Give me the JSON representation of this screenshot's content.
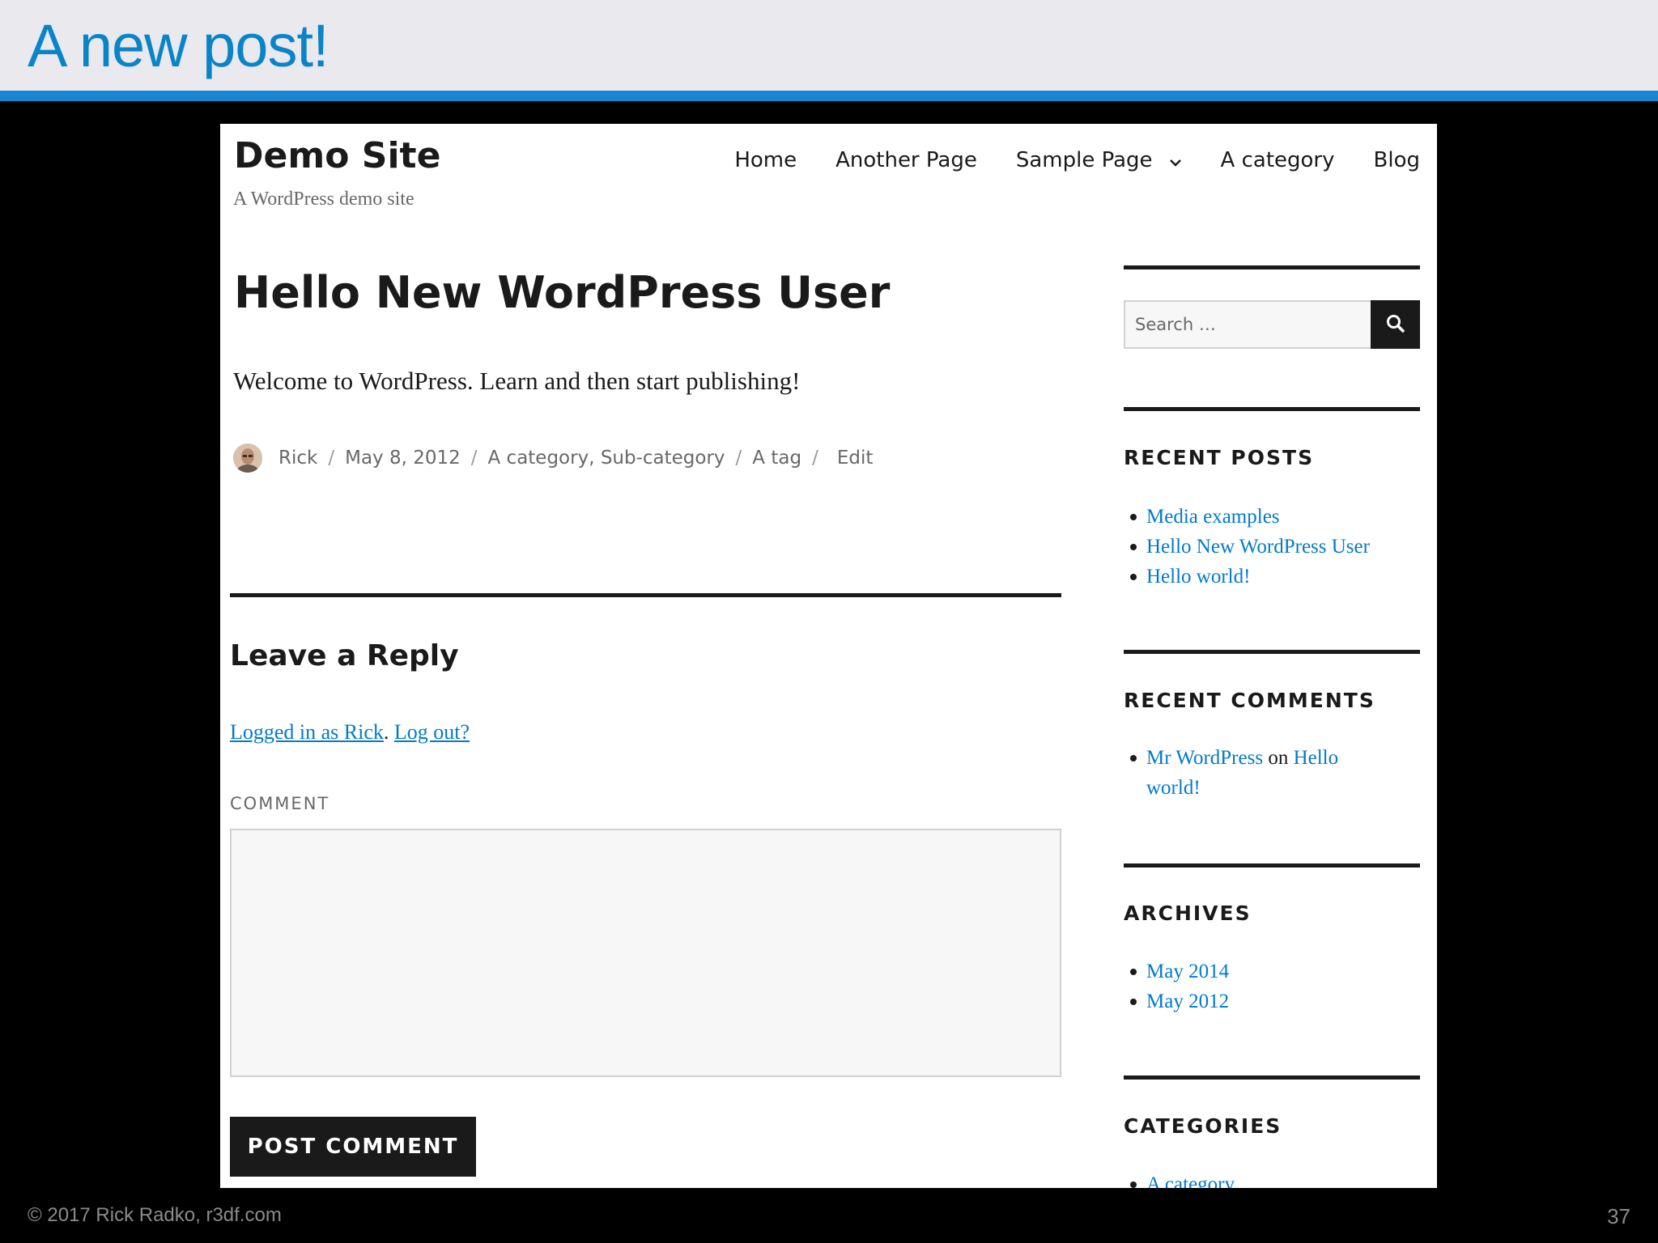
{
  "slide": {
    "title": "A new post!",
    "footer": "© 2017 Rick Radko, r3df.com",
    "page_number": "37"
  },
  "colors": {
    "slide_title": "#0a84c8",
    "slide_bar": "#1787d4",
    "link": "#007acc",
    "text": "#1a1a1a"
  },
  "site": {
    "title": "Demo Site",
    "description": "A WordPress demo site"
  },
  "nav": {
    "items": [
      "Home",
      "Another Page",
      "Sample Page",
      "A category",
      "Blog"
    ],
    "dropdown_icon": "chevron-down-icon"
  },
  "post": {
    "title": "Hello New WordPress User",
    "content": "Welcome to WordPress. Learn and then start publishing!",
    "author": "Rick",
    "date": "May 8, 2012",
    "categories": "A category, Sub-category",
    "tag": "A tag",
    "edit": "Edit",
    "separator": "/"
  },
  "reply": {
    "title": "Leave a Reply",
    "logged_in": "Logged in as Rick",
    "logout": "Log out?",
    "comment_label": "COMMENT",
    "comment_value": "",
    "submit": "POST COMMENT"
  },
  "sidebar": {
    "search_placeholder": "Search …",
    "search_icon": "search-icon",
    "recent_posts": {
      "title": "RECENT POSTS",
      "items": [
        "Media examples",
        "Hello New WordPress User",
        "Hello world!"
      ]
    },
    "recent_comments": {
      "title": "RECENT COMMENTS",
      "author": "Mr WordPress",
      "on": "on",
      "post": "Hello world!"
    },
    "archives": {
      "title": "ARCHIVES",
      "items": [
        "May 2014",
        "May 2012"
      ]
    },
    "categories": {
      "title": "CATEGORIES",
      "items": [
        "A category"
      ]
    }
  }
}
